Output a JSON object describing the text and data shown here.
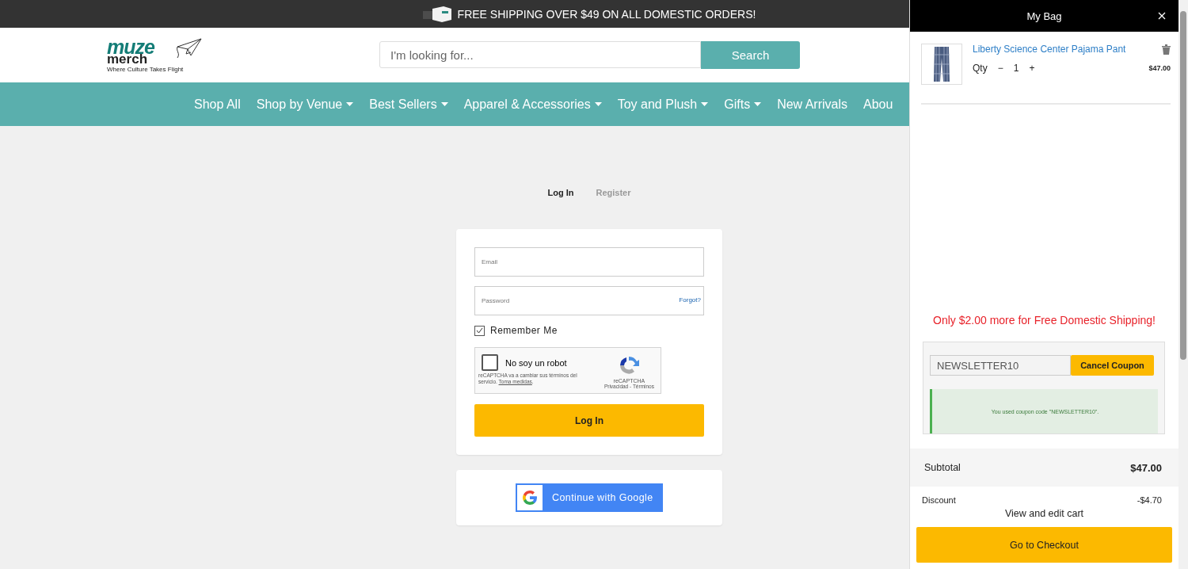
{
  "announcement": {
    "text": "FREE SHIPPING OVER $49 ON ALL DOMESTIC ORDERS!"
  },
  "logo": {
    "line_1": "muze",
    "line_2": "merch",
    "tagline": "Where Culture Takes Flight"
  },
  "search": {
    "placeholder": "I'm looking for...",
    "button": "Search"
  },
  "nav": [
    {
      "label": "Shop All",
      "dropdown": false
    },
    {
      "label": "Shop by Venue",
      "dropdown": true
    },
    {
      "label": "Best Sellers",
      "dropdown": true
    },
    {
      "label": "Apparel & Accessories",
      "dropdown": true
    },
    {
      "label": "Toy and Plush",
      "dropdown": true
    },
    {
      "label": "Gifts",
      "dropdown": true
    },
    {
      "label": "New Arrivals",
      "dropdown": false
    },
    {
      "label": "Abou",
      "dropdown": false
    }
  ],
  "auth_tabs": [
    {
      "label": "Log In",
      "selected": true
    },
    {
      "label": "Register",
      "selected": false
    }
  ],
  "login_form": {
    "email_placeholder": "Email",
    "password_placeholder": "Password",
    "forgot_link": "Forgot?",
    "remember": {
      "label": "Remember Me",
      "checked": true
    },
    "captcha": {
      "label": "No soy un robot",
      "checked": false,
      "notice": "reCAPTCHA va a cambiar sus términos del servicio.",
      "notice_link": "Toma medidas",
      "notice_end": ".",
      "brand": "reCAPTCHA",
      "links": "Privacidad - Términos"
    },
    "submit": "Log In"
  },
  "google_button": "Continue with Google",
  "bag": {
    "title": "My Bag",
    "items": [
      {
        "name": "Liberty Science Center Pajama Pant",
        "qty_label": "Qty",
        "minus": "−",
        "qty": "1",
        "plus": "+",
        "price": "$47.00"
      }
    ],
    "shipping_notice": "Only $2.00 more for Free Domestic Shipping!",
    "coupon": {
      "value": "NEWSLETTER10",
      "button": "Cancel Coupon",
      "message": "You used coupon code \"NEWSLETTER10\"."
    },
    "subtotal": {
      "label": "Subtotal",
      "value": "$47.00"
    },
    "discount": {
      "label": "Discount",
      "value": "-$4.70"
    },
    "view_cart": "View and edit cart",
    "checkout": "Go to Checkout"
  }
}
